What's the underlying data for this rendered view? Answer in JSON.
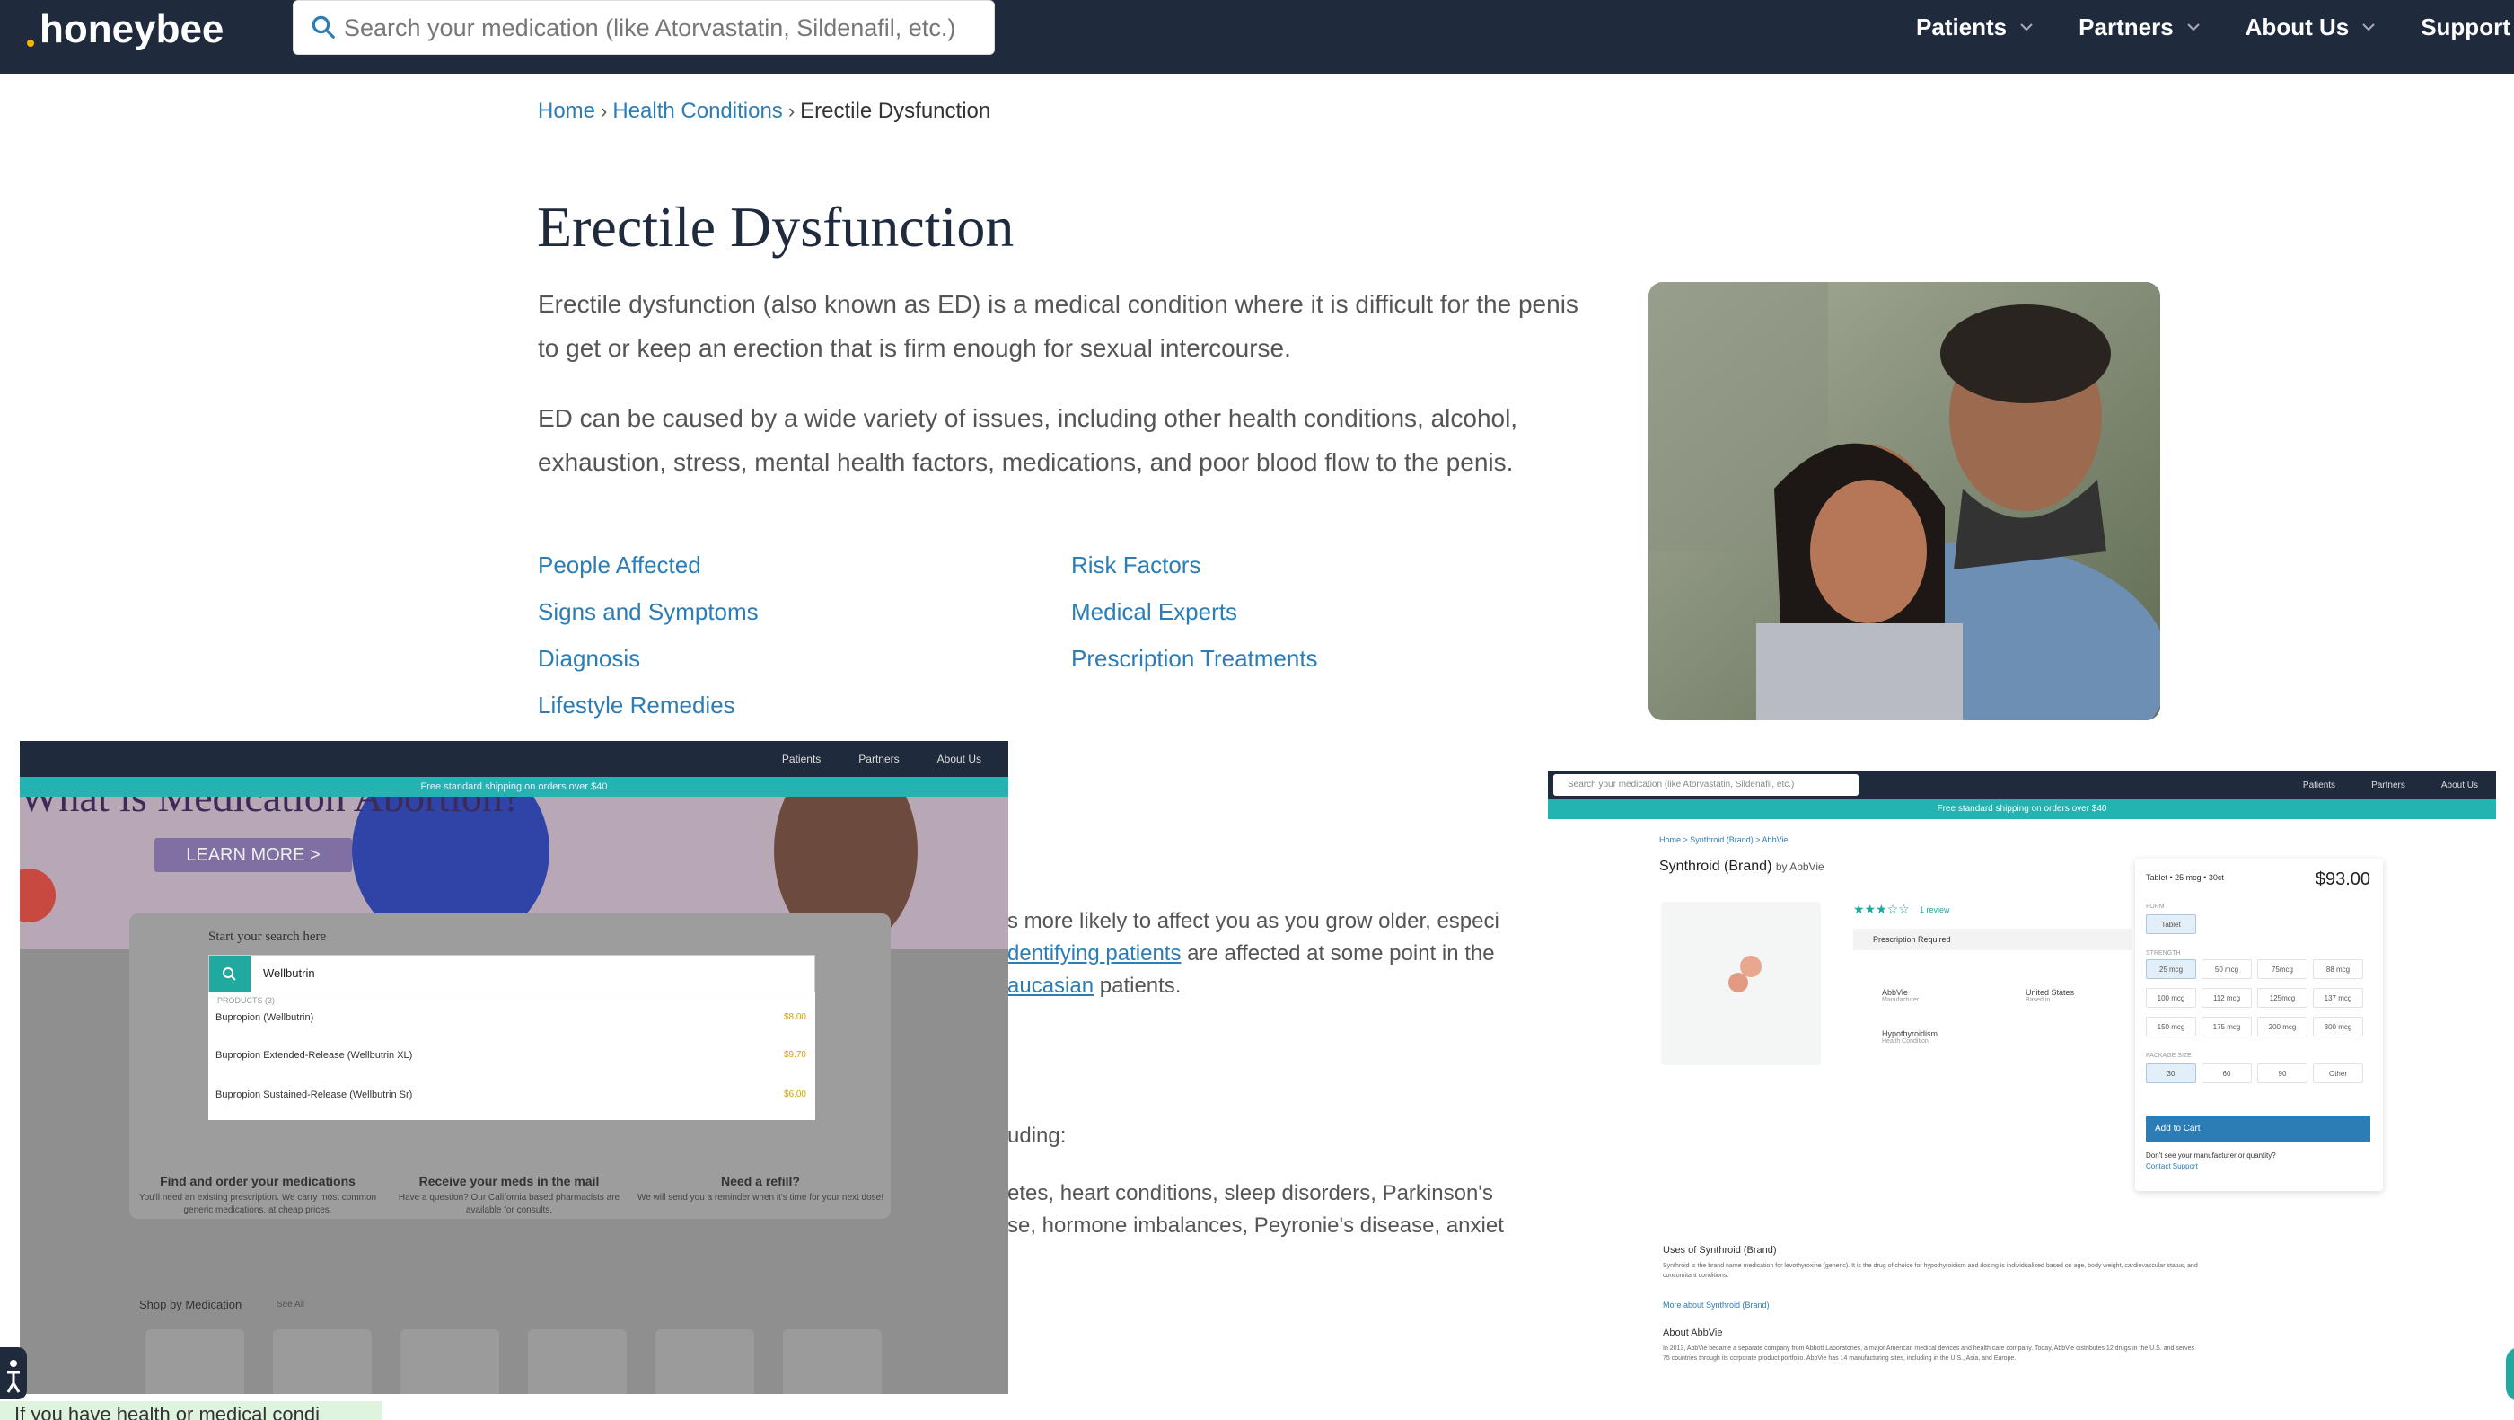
{
  "nav": {
    "logo": "honeybee",
    "search_placeholder": "Search your medication (like Atorvastatin, Sildenafil, etc.)",
    "items": [
      "Patients",
      "Partners",
      "About Us",
      "Support"
    ]
  },
  "breadcrumb": {
    "home": "Home",
    "health": "Health Conditions",
    "current": "Erectile Dysfunction"
  },
  "page": {
    "title": "Erectile Dysfunction",
    "para1": "Erectile dysfunction (also known as ED) is a medical condition where it is difficult for the penis to get or keep an erection that is firm enough for sexual intercourse.",
    "para2": "ED can be caused by a wide variety of issues, including other health conditions, alcohol, exhaustion, stress, mental health factors, medications, and poor blood flow to the penis.",
    "toc": [
      "People Affected",
      "Risk Factors",
      "Signs and Symptoms",
      "Medical Experts",
      "Diagnosis",
      "Prescription Treatments",
      "Lifestyle Remedies"
    ],
    "partial": {
      "l1": "s more likely to affect you as you grow older, especi",
      "l2_link": "dentifying patients",
      "l2_rest": " are affected at some point in the",
      "l3_link": "aucasian",
      "l3_rest": " patients.",
      "l4": "uding:",
      "l5": "etes, heart conditions, sleep disorders, Parkinson's",
      "l6": "se, hormone imbalances, Peyronie's disease, anxiet"
    }
  },
  "overlay_left": {
    "nav": [
      "Patients",
      "Partners",
      "About Us"
    ],
    "shipping": "Free standard shipping on orders over $40",
    "heading": "What is Medication Abortion?",
    "learn_more": "LEARN MORE >",
    "start_search": "Start your search here",
    "search_value": "Wellbutrin",
    "products_label": "PRODUCTS (3)",
    "results": [
      {
        "name": "Bupropion (Wellbutrin)",
        "price": "$8.00"
      },
      {
        "name": "Bupropion Extended-Release (Wellbutrin XL)",
        "price": "$9.70"
      },
      {
        "name": "Bupropion Sustained-Release (Wellbutrin Sr)",
        "price": "$6.00"
      }
    ],
    "features": [
      {
        "title": "Find and order your medications",
        "desc": "You'll need an existing prescription. We carry most common generic medications, at cheap prices."
      },
      {
        "title": "Receive your meds in the mail",
        "desc": "Have a question? Our California based pharmacists are available for consults."
      },
      {
        "title": "Need a refill?",
        "desc": "We will send you a reminder when it's time for your next dose!"
      }
    ],
    "shop": "Shop by Medication",
    "see_all": "See All"
  },
  "overlay_right": {
    "search_placeholder": "Search your medication (like Atorvastatin, Sildenafil, etc.)",
    "nav": [
      "Patients",
      "Partners",
      "About Us"
    ],
    "shipping": "Free standard shipping on orders over $40",
    "crumb": "Home > Synthroid (Brand) > AbbVie",
    "title": "Synthroid (Brand)",
    "by": "by AbbVie",
    "review": "1 review",
    "presc": "Prescription Required",
    "manufacturer": "AbbVie",
    "manufacturer_lbl": "Manufacturer",
    "based": "United States",
    "based_lbl": "Based in",
    "condition": "Hypothyroidism",
    "condition_lbl": "Health Condition",
    "card_title": "Tablet • 25 mcg • 30ct",
    "price": "$93.00",
    "form_lbl": "FORM",
    "form": "Tablet",
    "strength_lbl": "STRENGTH",
    "strengths": [
      "25 mcg",
      "50 mcg",
      "75mcg",
      "88 mcg",
      "100 mcg",
      "112 mcg",
      "125mcg",
      "137 mcg",
      "150 mcg",
      "175 mcg",
      "200 mcg",
      "300 mcg"
    ],
    "pkg_lbl": "PACKAGE SIZE",
    "pkgs": [
      "30",
      "60",
      "90",
      "Other"
    ],
    "add": "Add to Cart",
    "question": "Don't see your manufacturer or quantity?",
    "contact": "Contact Support",
    "uses_title": "Uses of Synthroid (Brand)",
    "uses_text": "Synthroid is the brand name medication for levothyroxine (generic). It is the drug of choice for hypothyroidism and dosing is individualized based on age, body weight, cardiovascular status, and concomitant conditions.",
    "more": "More about Synthroid (Brand)",
    "about_title": "About AbbVie",
    "about_text": "In 2013, AbbVie became a separate company from Abbott Laboratories, a major American medical devices and health care company. Today, AbbVie distributes 12 drugs in the U.S. and serves 75 countries through its corporate product portfolio. AbbVie has 14 manufacturing sites, including in the U.S., Asia, and Europe."
  },
  "footer_strip": "If you have health or medical condi"
}
